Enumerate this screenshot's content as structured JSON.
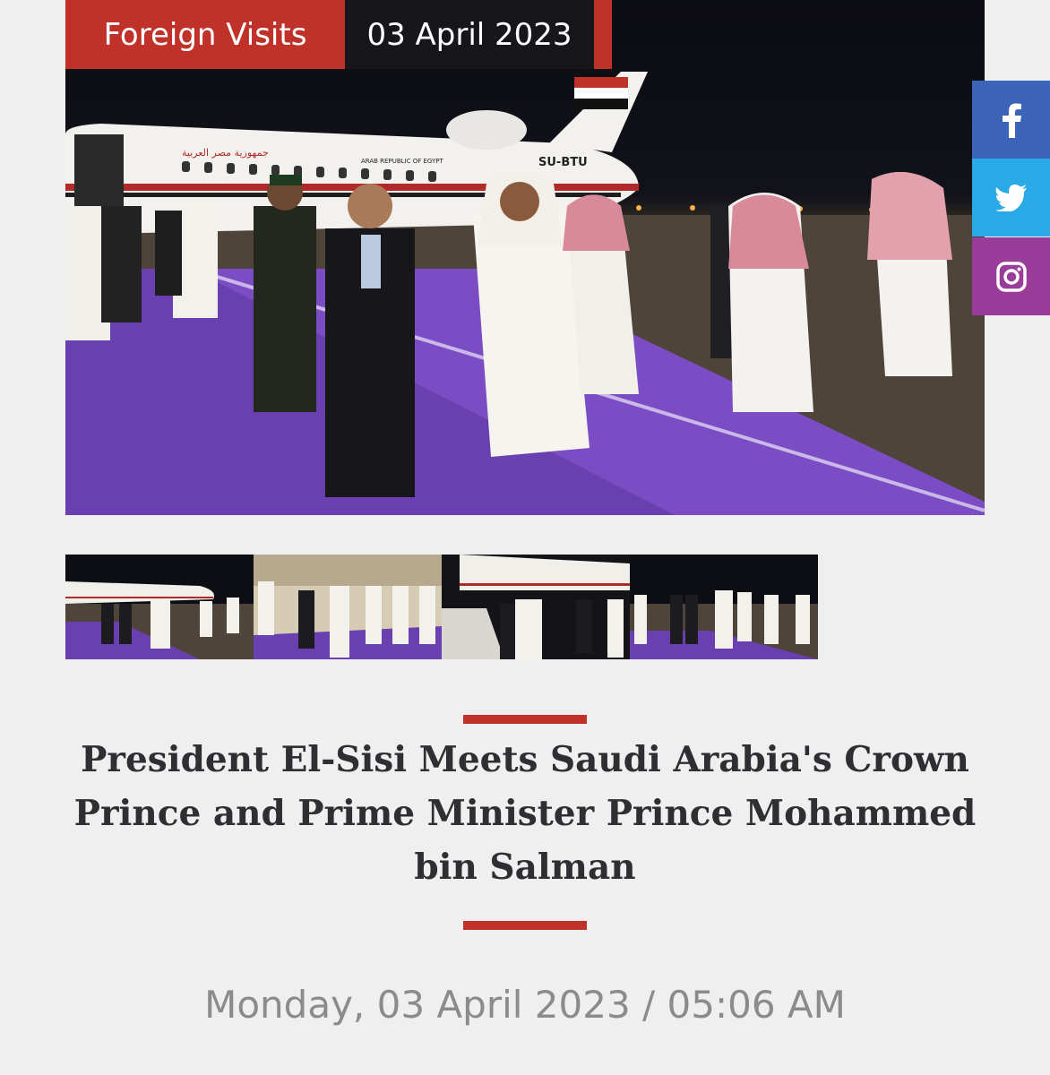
{
  "article": {
    "category": "Foreign Visits",
    "date_badge": "03 April 2023",
    "title": "President El-Sisi Meets Saudi Arabia's Crown Prince and Prime Minister Prince Mohammed bin Salman",
    "datetime": "Monday, 03 April 2023 / 05:06 AM"
  },
  "plane": {
    "arabic_label": "جمهورية مصر العربية",
    "english_label": "ARAB REPUBLIC OF EGYPT",
    "registration": "SU-BTU"
  },
  "social": {
    "facebook": "facebook-icon",
    "twitter": "twitter-icon",
    "instagram": "instagram-icon"
  },
  "gallery": {
    "count": 4
  },
  "colors": {
    "accent": "#c0312a",
    "dark": "#17171b",
    "facebook": "#3b63b8",
    "twitter": "#29a9e6",
    "instagram": "#9a3c9a",
    "carpet": "#6a3fb0",
    "title_text": "#2f2f33",
    "date_text": "#8b8b8b"
  }
}
